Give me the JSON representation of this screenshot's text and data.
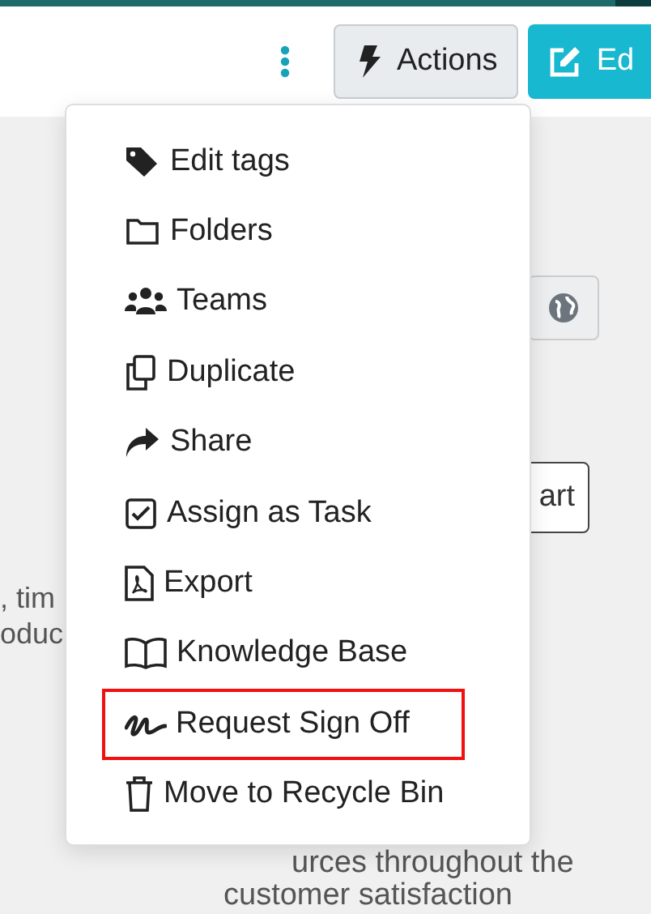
{
  "toolbar": {
    "actions_button": "Actions",
    "edit_button": "Ed"
  },
  "background": {
    "side_button": "art",
    "text_lines": [
      ", tim",
      "oduc"
    ],
    "bottom_lines": [
      "urces throughout the",
      "customer satisfaction"
    ]
  },
  "menu": {
    "items": [
      {
        "label": "Edit tags",
        "highlighted": false
      },
      {
        "label": "Folders",
        "highlighted": false
      },
      {
        "label": "Teams",
        "highlighted": false
      },
      {
        "label": "Duplicate",
        "highlighted": false
      },
      {
        "label": "Share",
        "highlighted": false
      },
      {
        "label": "Assign as Task",
        "highlighted": false
      },
      {
        "label": "Export",
        "highlighted": false
      },
      {
        "label": "Knowledge Base",
        "highlighted": false
      },
      {
        "label": "Request Sign Off",
        "highlighted": true
      },
      {
        "label": "Move to Recycle Bin",
        "highlighted": false
      }
    ]
  }
}
